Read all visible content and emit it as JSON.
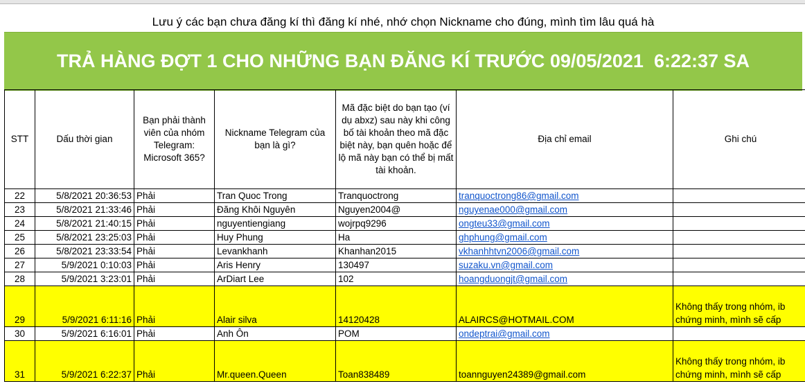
{
  "notice": "Lưu ý các bạn chưa đăng kí thì đăng kí nhé, nhớ chọn Nickname cho đúng, mình tìm lâu quá hà",
  "banner": "TRẢ HÀNG ĐỢT 1 CHO NHỮNG BẠN ĐĂNG KÍ TRƯỚC 09/05/2021  6:22:37 SA",
  "colors": {
    "banner_bg": "#93c749",
    "highlight": "#ffff00",
    "link": "#1155cc"
  },
  "headers": [
    "STT",
    "Dấu thời gian",
    "Bạn phải thành viên của nhóm Telegram: Microsoft 365?",
    "Nickname Telegram của bạn là gì?",
    "Mã đặc biệt do bạn tạo (ví dụ abxz) sau này khi công bố tài khoản theo mã đặc biệt này, bạn quên hoặc để lộ mã này bạn có thể bị mất tài khoản.",
    "Địa chỉ email",
    "Ghi chú"
  ],
  "rows": [
    {
      "stt": "22",
      "time": "5/8/2021 20:36:53",
      "member": "Phải",
      "nick": "Tran Quoc Trong",
      "code": "Tranquoctrong",
      "email": "tranquoctrong86@gmail.com",
      "note": ""
    },
    {
      "stt": "23",
      "time": "5/8/2021 21:33:46",
      "member": "Phải",
      "nick": "Đăng Khôi Nguyên",
      "code": "Nguyen2004@",
      "email": "nguyenae000@gmail.com",
      "note": ""
    },
    {
      "stt": "24",
      "time": "5/8/2021 21:40:15",
      "member": "Phải",
      "nick": "nguyentiengiang",
      "code": "wojrpq9296",
      "email": "ongteu33@gmail.com",
      "note": ""
    },
    {
      "stt": "25",
      "time": "5/8/2021 23:25:03",
      "member": "Phải",
      "nick": "Huy Phung",
      "code": "Ha",
      "email": "ghphung@gmail.com",
      "note": ""
    },
    {
      "stt": "26",
      "time": "5/8/2021 23:33:54",
      "member": "Phải",
      "nick": "Levankhanh",
      "code": "Khanhan2015",
      "email": "vkhanhhtvn2006@gmail.com",
      "note": ""
    },
    {
      "stt": "27",
      "time": "5/9/2021 0:10:03",
      "member": "Phải",
      "nick": "Aris Henry",
      "code": "130497",
      "email": "suzaku.vn@gmail.com",
      "note": ""
    },
    {
      "stt": "28",
      "time": "5/9/2021 3:23:01",
      "member": "Phải",
      "nick": "ArDiart Lee",
      "code": "102",
      "email": "hoangduongjt@gmail.com",
      "note": ""
    },
    {
      "stt": "29",
      "time": "5/9/2021 6:11:16",
      "member": "Phải",
      "nick": "Alair silva",
      "code": "14120428",
      "email": "ALAIRCS@HOTMAIL.COM",
      "note": "Không thấy trong nhóm, ib chứng minh, mình sẽ cấp"
    },
    {
      "stt": "30",
      "time": "5/9/2021 6:16:01",
      "member": "Phải",
      "nick": "Anh Ôn",
      "code": "POM",
      "email": "ondeptrai@gmail.com",
      "note": ""
    },
    {
      "stt": "31",
      "time": "5/9/2021 6:22:37",
      "member": "Phải",
      "nick": "Mr.queen.Queen",
      "code": "Toan838489",
      "email": "toannguyen24389@gmail.com",
      "note": "Không thấy trong nhóm, ib chứng minh, mình sẽ cấp"
    }
  ]
}
